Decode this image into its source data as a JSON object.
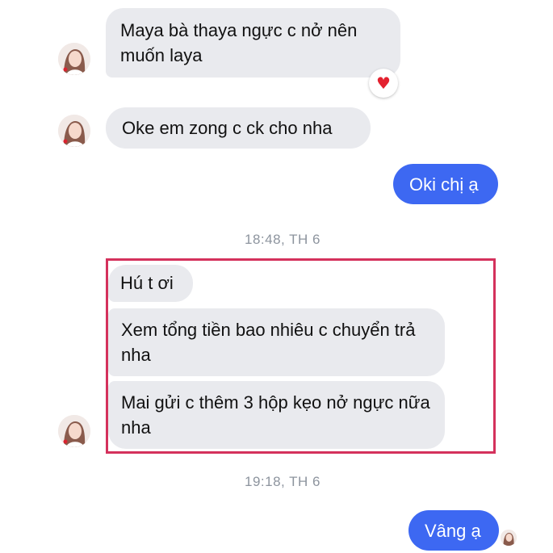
{
  "messages": {
    "m1": "Maya bà thaya ngực c nở nên muốn laya",
    "m2": "Oke em zong c ck cho nha",
    "m3": "Oki chị ạ",
    "m4": "Hú t ơi",
    "m5": "Xem tổng tiền bao nhiêu c chuyển trả nha",
    "m6": "Mai gửi c thêm 3 hộp kẹo nở ngực nữa nha",
    "m7": "Vâng ạ"
  },
  "timestamps": {
    "t1": "18:48, TH 6",
    "t2": "19:18, TH 6"
  },
  "reaction": {
    "icon": "heart-icon",
    "color": "#e3212f"
  },
  "colors": {
    "incoming_bubble": "#e9eaee",
    "outgoing_bubble": "#3d68f2",
    "highlight_border": "#d4315c",
    "timestamp_text": "#8d949e"
  }
}
